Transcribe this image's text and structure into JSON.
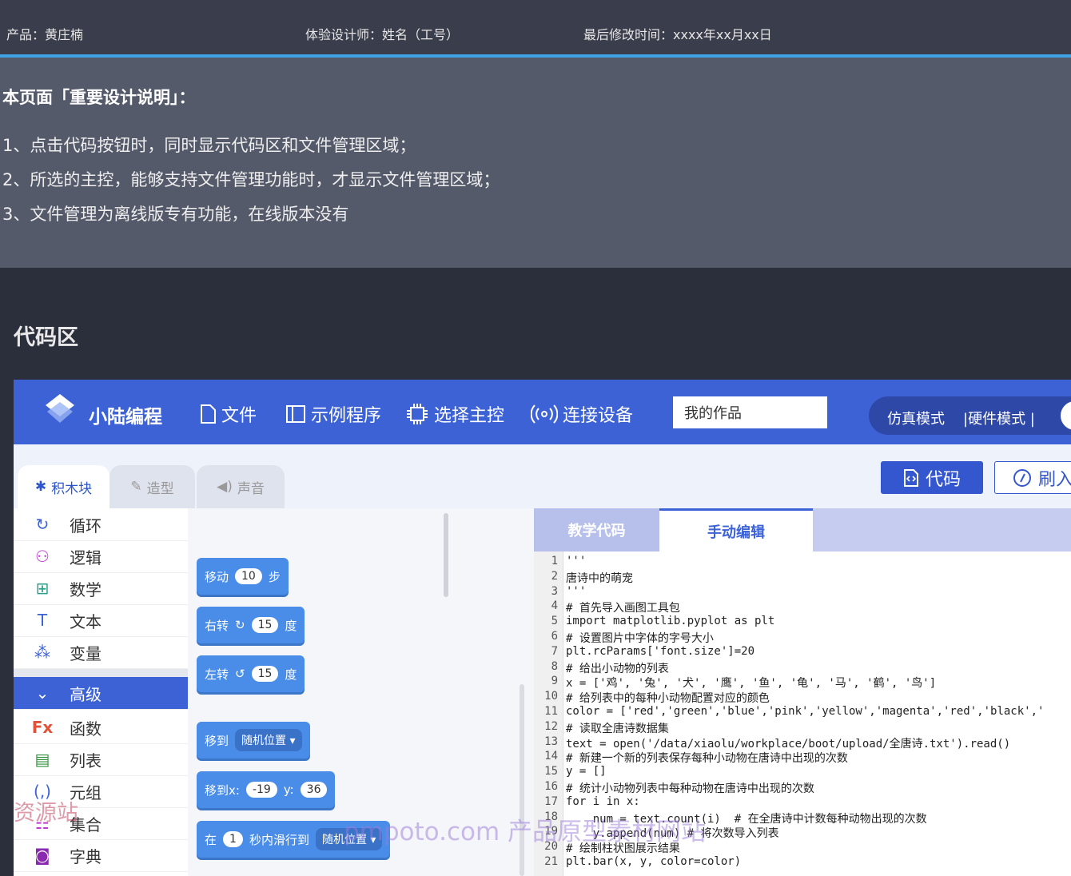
{
  "doc": {
    "product": "产品：黄庄楠",
    "designer": "体验设计师：姓名（工号）",
    "modified": "最后修改时间：xxxx年xx月xx日",
    "notes_heading": "本页面「重要设计说明」：",
    "notes": [
      "1、点击代码按钮时，同时显示代码区和文件管理区域；",
      "2、所选的主控，能够支持文件管理功能时，才显示文件管理区域；",
      "3、文件管理为离线版专有功能，在线版本没有"
    ],
    "section_title": "代码区"
  },
  "app": {
    "brand": "小陆编程",
    "nav": [
      {
        "label": "文件",
        "icon": "file-icon"
      },
      {
        "label": "示例程序",
        "icon": "examples-icon"
      },
      {
        "label": "选择主控",
        "icon": "chip-icon"
      },
      {
        "label": "连接设备",
        "icon": "signal-icon"
      }
    ],
    "works_value": "我的作品",
    "mode_sim": "仿真模式",
    "mode_hw": "|硬件模式 |",
    "tabs": {
      "blocks": "积木块",
      "shape": "造型",
      "sound": "声音"
    },
    "code_button": "代码",
    "flash_button": "刷入",
    "categories": [
      {
        "label": "循环",
        "icon": "loop-icon",
        "color": "#3c62d6"
      },
      {
        "label": "逻辑",
        "icon": "logic-icon",
        "color": "#c23ad6"
      },
      {
        "label": "数学",
        "icon": "math-icon",
        "color": "#2aa08a"
      },
      {
        "label": "文本",
        "icon": "text-icon",
        "color": "#3c62d6"
      },
      {
        "label": "变量",
        "icon": "variable-icon",
        "color": "#3c62d6"
      },
      {
        "label": "高级",
        "icon": "chevron-down-icon",
        "color": "#fff"
      },
      {
        "label": "函数",
        "icon": "function-icon",
        "color": "#e0533a"
      },
      {
        "label": "列表",
        "icon": "list-icon",
        "color": "#2f8f3a"
      },
      {
        "label": "元组",
        "icon": "tuple-icon",
        "color": "#3c62d6"
      },
      {
        "label": "集合",
        "icon": "set-icon",
        "color": "#c23ad6"
      },
      {
        "label": "字典",
        "icon": "dict-icon",
        "color": "#8a2ab0"
      }
    ],
    "blocks": [
      {
        "parts": [
          "移动",
          "10",
          "步"
        ]
      },
      {
        "parts": [
          "右转",
          "15",
          "度"
        ]
      },
      {
        "parts": [
          "左转",
          "15",
          "度"
        ]
      },
      {
        "parts": [
          "移到",
          "随机位置 ▾"
        ]
      },
      {
        "parts": [
          "移到x:",
          "-19",
          "y:",
          "36"
        ]
      },
      {
        "parts": [
          "在",
          "1",
          "秒内滑行到",
          "随机位置 ▾"
        ]
      }
    ],
    "code_tabs": {
      "teach": "教学代码",
      "manual": "手动编辑"
    },
    "code_lines": [
      "'''",
      "唐诗中的萌宠",
      "'''",
      "# 首先导入画图工具包",
      "import matplotlib.pyplot as plt",
      "# 设置图片中字体的字号大小",
      "plt.rcParams['font.size']=20",
      "# 给出小动物的列表",
      "x = ['鸡', '兔', '犬', '鹰', '鱼', '龟', '马', '鹤', '鸟']",
      "# 给列表中的每种小动物配置对应的颜色",
      "color = ['red','green','blue','pink','yellow','magenta','red','black','",
      "# 读取全唐诗数据集",
      "text = open('/data/xiaolu/workplace/boot/upload/全唐诗.txt').read()",
      "# 新建一个新的列表保存每种小动物在唐诗中出现的次数",
      "y = []",
      "# 统计小动物列表中每种动物在唐诗中出现的次数",
      "for i in x:",
      "    num = text.count(i)  # 在全唐诗中计数每种动物出现的次数",
      "    y.append(num) # 将次数导入列表",
      "# 绘制柱状图展示结果",
      "plt.bar(x, y, color=color)"
    ]
  },
  "watermarks": {
    "left": "资源站",
    "center": "pmpoto.com 产品原型素材网站"
  }
}
